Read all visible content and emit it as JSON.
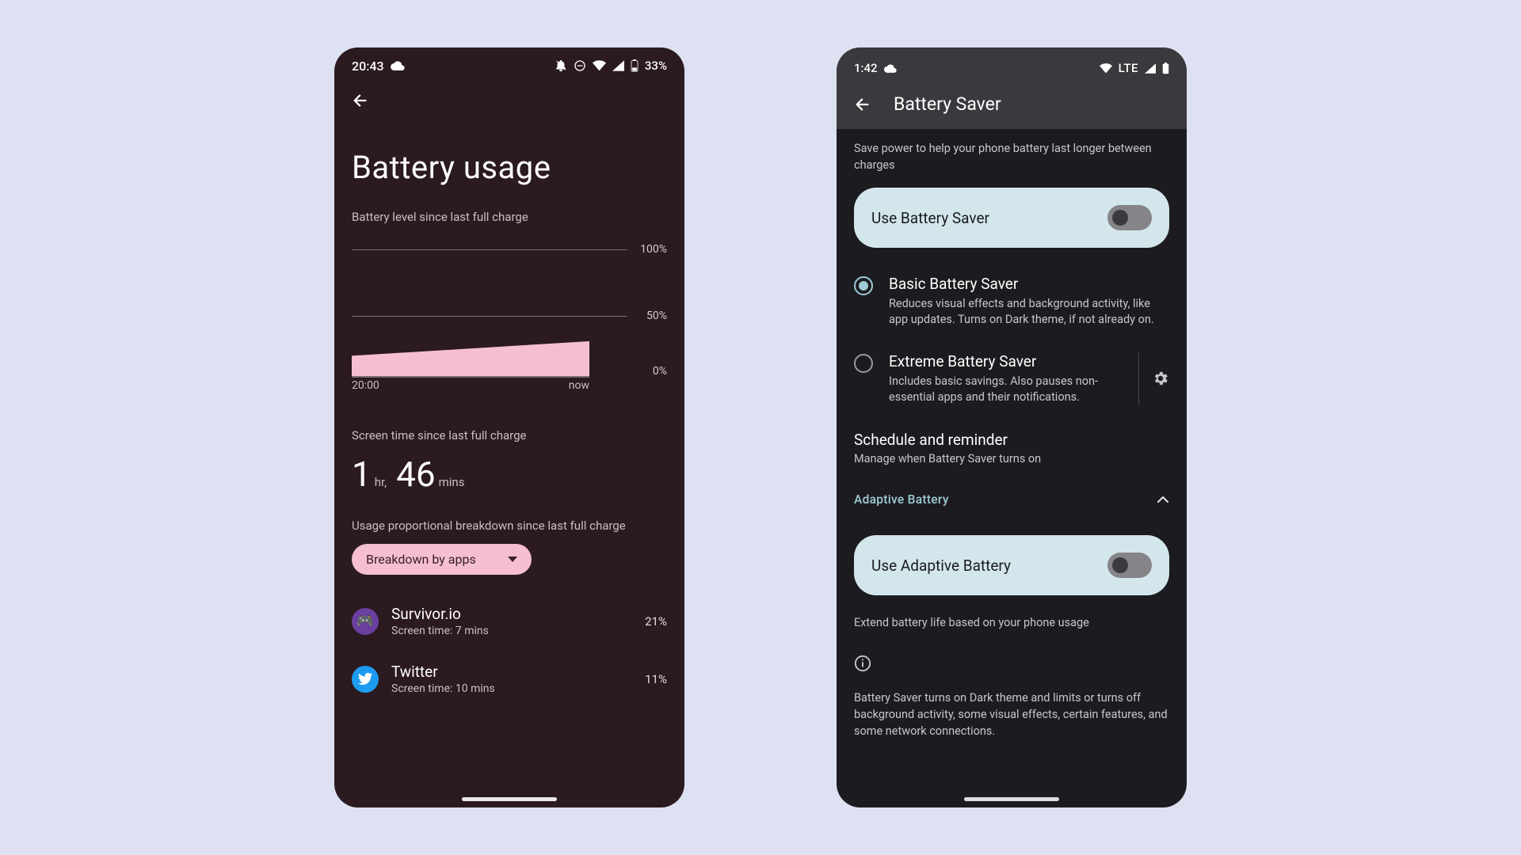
{
  "chart_data": {
    "type": "area",
    "title": "Battery level since last full charge",
    "xlabel": "",
    "ylabel": "",
    "x": [
      "20:00",
      "now"
    ],
    "values": [
      25,
      33
    ],
    "ylim": [
      0,
      100
    ],
    "yticks": [
      0,
      50,
      100
    ],
    "x_tick_labels": [
      "20:00",
      "now"
    ]
  },
  "phone1": {
    "status": {
      "time": "20:43",
      "battery_pct": "33%"
    },
    "title": "Battery usage",
    "chart_sub": "Battery level since last full charge",
    "chart_y100": "100%",
    "chart_y50": "50%",
    "chart_y0": "0%",
    "chart_x_start": "20:00",
    "chart_x_end": "now",
    "screen_time_label": "Screen time since last full charge",
    "hr_val": "1",
    "hr_unit": "hr,",
    "min_val": "46",
    "min_unit": "mins",
    "breakdown_label": "Usage proportional breakdown since last full charge",
    "dropdown_label": "Breakdown by apps",
    "apps": [
      {
        "name": "Survivor.io",
        "sub": "Screen time: 7 mins",
        "pct": "21%"
      },
      {
        "name": "Twitter",
        "sub": "Screen time: 10 mins",
        "pct": "11%"
      }
    ]
  },
  "phone2": {
    "status": {
      "time": "1:42",
      "network": "LTE"
    },
    "header": "Battery Saver",
    "intro": "Save power to help your phone battery last longer between charges",
    "use_bs": "Use Battery Saver",
    "basic_title": "Basic Battery Saver",
    "basic_sub": "Reduces visual effects and background activity, like app updates. Turns on Dark theme, if not already on.",
    "extreme_title": "Extreme Battery Saver",
    "extreme_sub": "Includes basic savings. Also pauses non-essential apps and their notifications.",
    "sched_title": "Schedule and reminder",
    "sched_sub": "Manage when Battery Saver turns on",
    "adaptive_label": "Adaptive Battery",
    "use_adaptive": "Use Adaptive Battery",
    "adaptive_info": "Extend battery life based on your phone usage",
    "footer_info": "Battery Saver turns on Dark theme and limits or turns off background activity, some visual effects, certain features, and some network connections."
  }
}
